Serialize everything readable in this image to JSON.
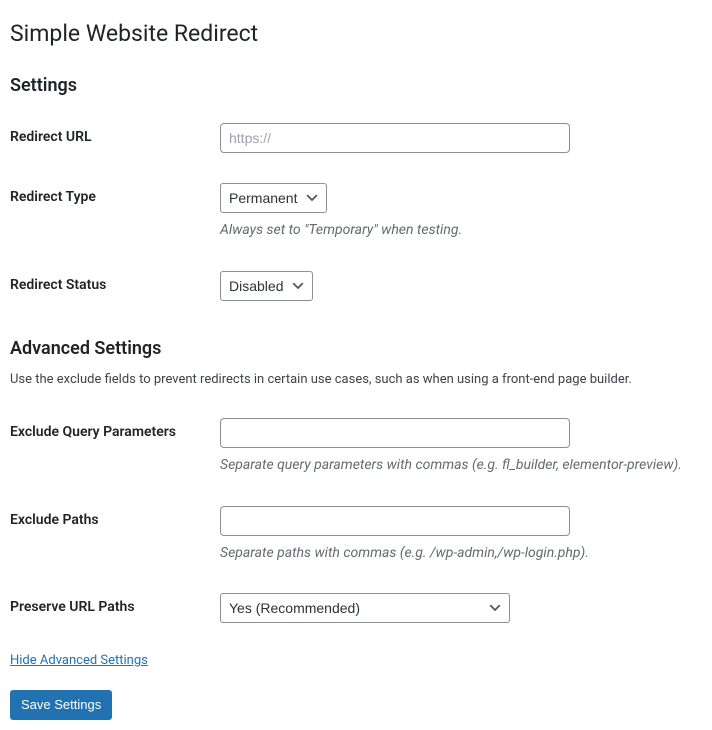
{
  "page_title": "Simple Website Redirect",
  "settings": {
    "heading": "Settings",
    "redirect_url": {
      "label": "Redirect URL",
      "placeholder": "https://",
      "value": ""
    },
    "redirect_type": {
      "label": "Redirect Type",
      "value": "Permanent",
      "help": "Always set to \"Temporary\" when testing."
    },
    "redirect_status": {
      "label": "Redirect Status",
      "value": "Disabled"
    }
  },
  "advanced": {
    "heading": "Advanced Settings",
    "description": "Use the exclude fields to prevent redirects in certain use cases, such as when using a front-end page builder.",
    "exclude_query": {
      "label": "Exclude Query Parameters",
      "value": "",
      "help": "Separate query parameters with commas (e.g. fl_builder, elementor-preview)."
    },
    "exclude_paths": {
      "label": "Exclude Paths",
      "value": "",
      "help": "Separate paths with commas (e.g. /wp-admin,/wp-login.php)."
    },
    "preserve_paths": {
      "label": "Preserve URL Paths",
      "value": "Yes (Recommended)"
    },
    "toggle_link": "Hide Advanced Settings"
  },
  "submit_label": "Save Settings"
}
